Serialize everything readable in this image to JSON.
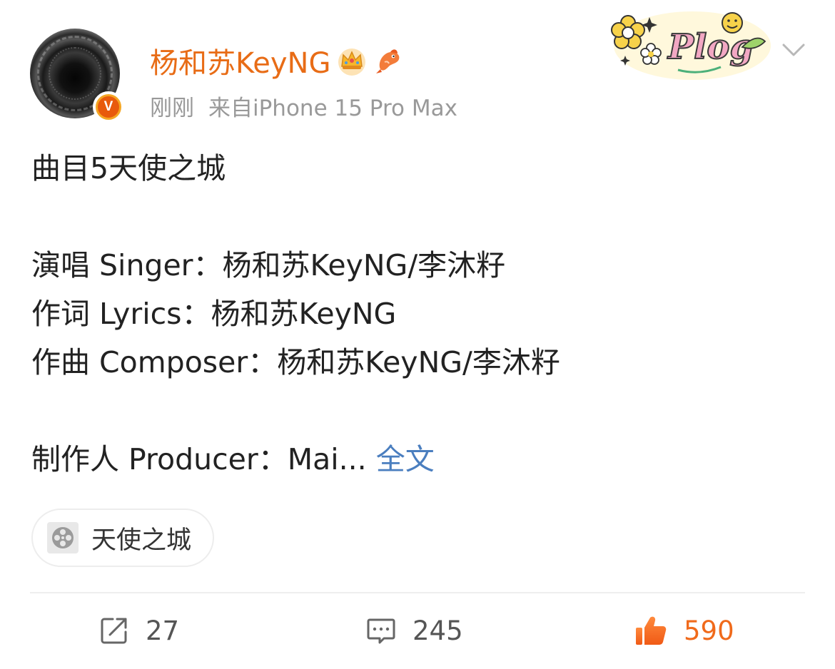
{
  "user": {
    "name": "杨和苏KeyNG",
    "timestamp": "刚刚",
    "source": "来自iPhone 15 Pro Max",
    "verified_badge": "V",
    "badges": [
      "crown-icon",
      "fish-icon"
    ]
  },
  "decoration": {
    "sticker": "Plog"
  },
  "post": {
    "line1": "曲目5天使之城",
    "line2": "演唱 Singer：杨和苏KeyNG/李沐籽",
    "line3": "作词 Lyrics：杨和苏KeyNG",
    "line4": "作曲 Composer：杨和苏KeyNG/李沐籽",
    "line5": "制作人 Producer：Mai...",
    "full_text_link": "全文"
  },
  "topic": {
    "icon": "film-reel-icon",
    "label": "天使之城"
  },
  "actions": {
    "repost": "27",
    "comment": "245",
    "like": "590"
  },
  "colors": {
    "username": "#e86c16",
    "link": "#4a7ebf",
    "meta": "#999999",
    "like_active": "#f06a1b"
  }
}
